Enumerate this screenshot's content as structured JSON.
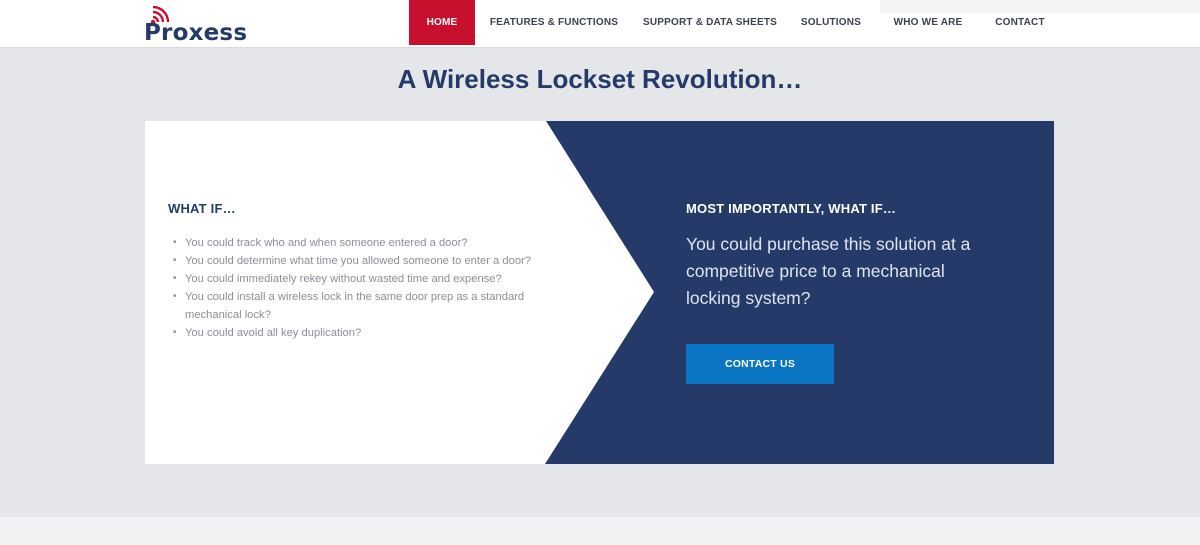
{
  "brand": {
    "name": "Proxess",
    "wave_color": "#c8102e",
    "text_color": "#263a6a"
  },
  "nav": {
    "items": [
      {
        "label": "HOME",
        "active": true
      },
      {
        "label": "FEATURES & FUNCTIONS",
        "active": false
      },
      {
        "label": "SUPPORT & DATA SHEETS",
        "active": false
      },
      {
        "label": "SOLUTIONS",
        "active": false
      },
      {
        "label": "WHO WE ARE",
        "active": false
      },
      {
        "label": "CONTACT",
        "active": false
      }
    ],
    "active_color": "#c8102e"
  },
  "hero": {
    "title": "A Wireless Lockset Revolution…"
  },
  "left": {
    "heading": "WHAT IF…",
    "bullets": [
      "You could track who and when someone entered a door?",
      "You could determine what time you allowed someone to enter a door?",
      "You could immediately rekey without wasted time and expense?",
      "You could install a wireless lock in the same door prep as a standard mechanical lock?",
      "You could avoid all key duplication?"
    ]
  },
  "right": {
    "heading": "MOST IMPORTANTLY, WHAT IF…",
    "text": "You could purchase this solution at a competitive price to a mechanical locking system?",
    "cta_label": "CONTACT US",
    "background_color": "#263a6a",
    "cta_color": "#0a75c2"
  }
}
